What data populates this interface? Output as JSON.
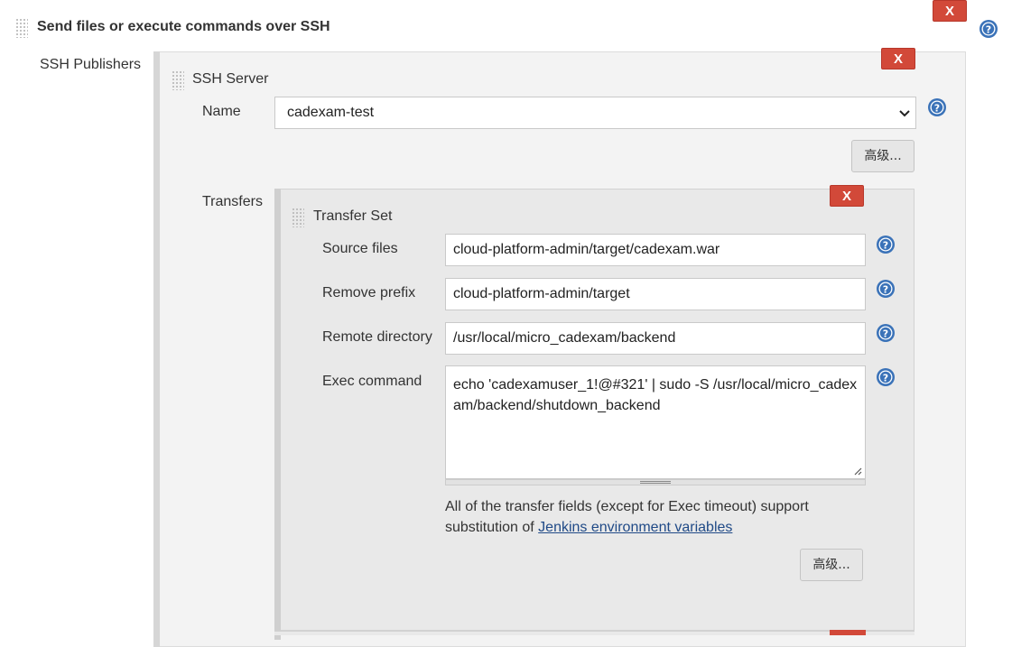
{
  "section": {
    "title": "Send files or execute commands over SSH",
    "delete_label": "X"
  },
  "publishers": {
    "label": "SSH Publishers",
    "server": {
      "title": "SSH Server",
      "delete_label": "X",
      "name_label": "Name",
      "name_value": "cadexam-test",
      "advanced_label": "高级..."
    },
    "transfers_label": "Transfers",
    "transfer_set": {
      "title": "Transfer Set",
      "delete_label": "X",
      "source_files_label": "Source files",
      "source_files_value": "cloud-platform-admin/target/cadexam.war",
      "remove_prefix_label": "Remove prefix",
      "remove_prefix_value": "cloud-platform-admin/target",
      "remote_directory_label": "Remote directory",
      "remote_directory_value": "/usr/local/micro_cadexam/backend",
      "exec_command_label": "Exec command",
      "exec_command_value": "echo 'cadexamuser_1!@#321' | sudo -S /usr/local/micro_cadexam/backend/shutdown_backend",
      "note_text": "All of the transfer fields (except for Exec timeout) support substitution of ",
      "note_link": "Jenkins environment variables",
      "advanced_label": "高级..."
    }
  },
  "colors": {
    "delete_red": "#d24939",
    "help_blue": "#3a72b8",
    "panel_grey": "#f0f0f0",
    "inner_panel_grey": "#e8e8e8"
  },
  "icons": {
    "help": "question-circle-icon",
    "grip": "drag-handle-icon",
    "select_arrow": "chevron-down-icon",
    "resize": "resize-grip-icon"
  }
}
